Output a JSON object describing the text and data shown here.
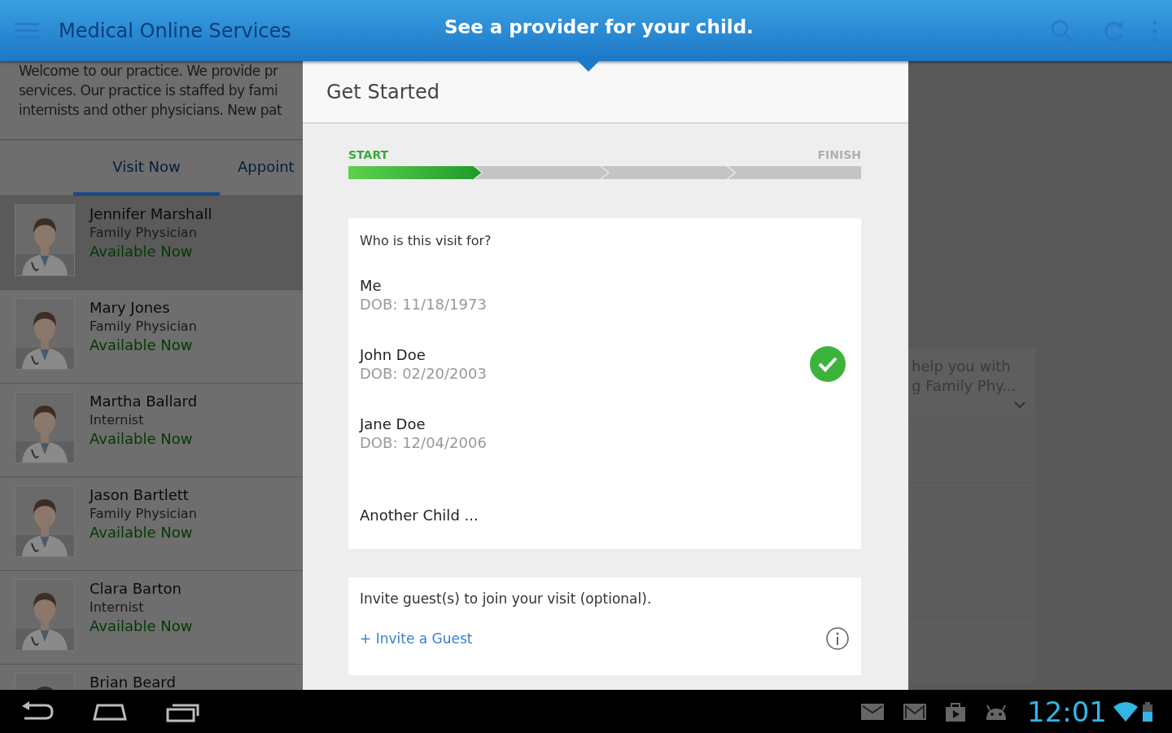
{
  "app_bar": {
    "title": "Medical Online Services",
    "hint": "See a provider for your child."
  },
  "welcome": {
    "lines": [
      "Welcome to our practice. We provide pr",
      "services. Our practice is staffed by fami",
      "internists and other physicians. New pat"
    ]
  },
  "tabs": [
    {
      "label": "Visit Now",
      "selected": true
    },
    {
      "label": "Appoint",
      "selected": false
    }
  ],
  "providers": [
    {
      "name": "Jennifer Marshall",
      "specialty": "Family Physician",
      "status": "Available Now",
      "selected": true
    },
    {
      "name": "Mary Jones",
      "specialty": "Family Physician",
      "status": "Available Now",
      "selected": false
    },
    {
      "name": "Martha Ballard",
      "specialty": "Internist",
      "status": "Available Now",
      "selected": false
    },
    {
      "name": "Jason Bartlett",
      "specialty": "Family Physician",
      "status": "Available Now",
      "selected": false
    },
    {
      "name": "Clara Barton",
      "specialty": "Internist",
      "status": "Available Now",
      "selected": false
    },
    {
      "name": "Brian Beard",
      "selected": false
    }
  ],
  "side_card": {
    "lines": [
      "help you with",
      "g Family Phy..."
    ]
  },
  "dialog": {
    "title": "Get Started",
    "progress": {
      "start": "START",
      "finish": "FINISH",
      "steps": [
        {
          "completed": true
        },
        {
          "completed": false
        },
        {
          "completed": false
        },
        {
          "completed": false
        }
      ]
    },
    "question": "Who is this visit for?",
    "patients": [
      {
        "kind": "person",
        "name": "Me",
        "dob": "DOB: 11/18/1973",
        "selected": false
      },
      {
        "kind": "person",
        "name": "John Doe",
        "dob": "DOB: 02/20/2003",
        "selected": true
      },
      {
        "kind": "person",
        "name": "Jane Doe",
        "dob": "DOB: 12/04/2006",
        "selected": false
      },
      {
        "kind": "other",
        "name": "Another Child ...",
        "selected": false
      }
    ],
    "guests": {
      "text": "Invite guest(s) to join your visit (optional).",
      "link": "+ Invite a Guest"
    }
  },
  "status_bar": {
    "time": "12:01"
  }
}
